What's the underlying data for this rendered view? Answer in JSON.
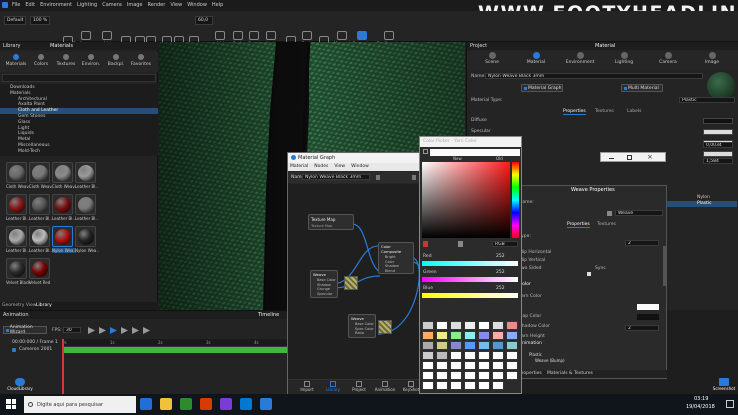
{
  "watermark": "WWW.FOOTYHEADLINES.COM",
  "menu": [
    "File",
    "Edit",
    "Environment",
    "Lighting",
    "Camera",
    "Image",
    "Render",
    "View",
    "Window",
    "Help"
  ],
  "toolbar": {
    "workspace_value": "Default",
    "zoom_value": "100 %",
    "fov_value": "60,0",
    "left_labels": [
      "Workspaces",
      "CPU Usage",
      "Pause",
      "Performance Mode",
      "Add Camera",
      "Region",
      "Move Tool"
    ],
    "mid_labels": [
      "Tumble",
      "Pan",
      "Dolly",
      "Perspective",
      "Add Camera",
      "Cycle Camera",
      "Reset Camera",
      "Lock Camera",
      "Add Studio",
      "Cycle Studio",
      "Studios",
      "Material Templates",
      "Geometry View",
      "Configurator Wizard"
    ]
  },
  "library": {
    "title": "Library",
    "materials_header": "Materials",
    "tabs": [
      "Materials",
      "Colors",
      "Textures",
      "Environ.",
      "Backpl.",
      "Favorites"
    ],
    "tree": [
      "Downloads",
      "Materials",
      "Architectural",
      "Axalta Paint",
      "Cloth and Leather",
      "Gem Stones",
      "Glass",
      "Light",
      "Liquids",
      "Metal",
      "Miscellaneous",
      "Mold-Tech"
    ],
    "selected_index": 4,
    "thumbs": [
      {
        "label": "Cloth Weav..",
        "color": "#6a6a6a"
      },
      {
        "label": "Cloth Weav..",
        "color": "#777"
      },
      {
        "label": "Cloth Weav..",
        "color": "#8a8a8a"
      },
      {
        "label": "Leather Bl..",
        "color": "#9a9a9a"
      },
      {
        "label": "Leather Bl..",
        "color": "#8a1515"
      },
      {
        "label": "Leather Bl..",
        "color": "#555"
      },
      {
        "label": "Leather Bl..",
        "color": "#7a0f0f"
      },
      {
        "label": "Leather Bl..",
        "color": "#7a7a7a"
      },
      {
        "label": "Leather Bl..",
        "color": "#aaa"
      },
      {
        "label": "Leather Bl..",
        "color": "#bbb"
      },
      {
        "label": "Nylon Wea..",
        "color": "#b01010"
      },
      {
        "label": "Nylon Wea..",
        "color": "#222"
      },
      {
        "label": "Velvet Black",
        "color": "#2a2a2a"
      },
      {
        "label": "Velvet Red",
        "color": "#7a0000"
      }
    ],
    "bottom_tabs": [
      "Geometry View",
      "Library"
    ]
  },
  "animation": {
    "title": "Animation",
    "timeline_title": "Timeline",
    "sub_tab": "Animation Wizard",
    "fps_label": "FPS:",
    "fps_value": "30",
    "time_value": "00:00:000 / Frame 1",
    "item": "Cameron 2001",
    "ticks": [
      "0s",
      "1s",
      "2s",
      "3s",
      "4s"
    ]
  },
  "material_graph": {
    "title": "Material Graph",
    "menu": [
      "Material",
      "Nodes",
      "View",
      "Window"
    ],
    "name_label": "Name",
    "name_value": "Nylon Weave Black 3mm",
    "nodes": {
      "texture": {
        "title": "Texture Map",
        "sub": "Texture Map"
      },
      "composite": {
        "title": "Color Composite",
        "ports": [
          "Bright",
          "Color",
          "Shadow",
          "Blend"
        ]
      },
      "weave": {
        "title": "Weave",
        "ports": [
          "Base Color",
          "Shadow",
          "Grunge",
          "Specular"
        ]
      },
      "weave2": {
        "title": "Weave",
        "ports": [
          "Base Color",
          "Spec Color",
          "Ratio"
        ]
      }
    },
    "bottom": [
      "Import",
      "Library",
      "Project",
      "Animation",
      "KeyShot"
    ]
  },
  "color_picker": {
    "title": "Color Picker - Yarn Color",
    "tabs": [
      "New",
      "Old"
    ],
    "mode_value": "RGB",
    "channels": [
      {
        "label": "Red",
        "value": "252"
      },
      {
        "label": "Green",
        "value": "252"
      },
      {
        "label": "Blue",
        "value": "252"
      }
    ]
  },
  "project": {
    "title": "Project",
    "material_header": "Material",
    "top_tabs": [
      "Scene",
      "Material",
      "Environment",
      "Lighting",
      "Camera",
      "Image"
    ],
    "name_label": "Name:",
    "name_value": "Nylon Weave Black 3mm",
    "material_graph_button": "Material Graph",
    "multi_material_button": "Multi Material",
    "material_type_label": "Material Type:",
    "material_type_value": "Plastic",
    "sub_tabs": [
      "Properties",
      "Textures",
      "Labels"
    ],
    "rows": [
      "Diffuse",
      "Specular",
      "Roughness",
      "Refraction Index"
    ],
    "values": [
      "0,0034",
      "1,584"
    ],
    "list": [
      "Nylon",
      "Plastic"
    ]
  },
  "weave_props": {
    "title": "Weave Properties",
    "name_label": "Name:",
    "name_value": "Weave",
    "tabs": [
      "Properties",
      "Textures"
    ],
    "rows": [
      "Type:",
      "Flip Horizontal",
      "Flip Vertical",
      "Two Sided",
      "Sync",
      "Color",
      "Yarn Color",
      "Gap Color",
      "Shadow Color",
      "Yarn Height"
    ],
    "section": "Animation",
    "tree": [
      "Plastic",
      "Weave (Bump)"
    ],
    "bottom_tabs": [
      "Properties",
      "Materials & Textures"
    ],
    "value": "2"
  },
  "taskbar": {
    "search_placeholder": "Digite aqui para pesquisar",
    "time": "03:19",
    "date": "19/04/2018",
    "cloud_label": "CloudLibrary",
    "screenshot_label": "Screenshot"
  },
  "colors": {
    "accent": "#2a7ad8",
    "timeline_bar": "#3fb83f",
    "selection": "#264f78",
    "fabric": "#2d5f3e"
  }
}
